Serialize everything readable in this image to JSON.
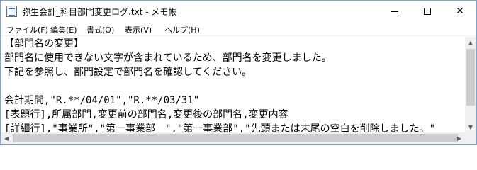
{
  "window": {
    "title": "弥生会計_科目部門変更ログ.txt - メモ帳",
    "app_icon": "notepad-icon",
    "controls": {
      "minimize_icon": "minimize-icon",
      "maximize_icon": "maximize-icon",
      "close_icon": "close-icon",
      "close_glyph": "✕"
    }
  },
  "menu": {
    "items": [
      {
        "label": "ファイル(F)"
      },
      {
        "label": "編集(E)"
      },
      {
        "label": "書式(O)"
      },
      {
        "label": "表示(V)"
      },
      {
        "label": "ヘルプ(H)"
      }
    ]
  },
  "editor": {
    "lines": [
      "【部門名の変更】",
      "部門名に使用できない文字が含まれているため、部門名を変更しました。",
      "下記を参照し、部門設定で部門名を確認してください。",
      "",
      "会計期間,\"R.**/04/01\",\"R.**/03/31\"",
      "[表題行],所属部門,変更前の部門名,変更後の部門名,変更内容",
      "[詳細行],\"事業所\",\"第一事業部　\",\"第一事業部\",\"先頭または末尾の空白を削除しました。\""
    ]
  },
  "scrollbars": {
    "up_glyph": "▲",
    "down_glyph": "▼",
    "left_glyph": "◀",
    "right_glyph": "▶"
  }
}
